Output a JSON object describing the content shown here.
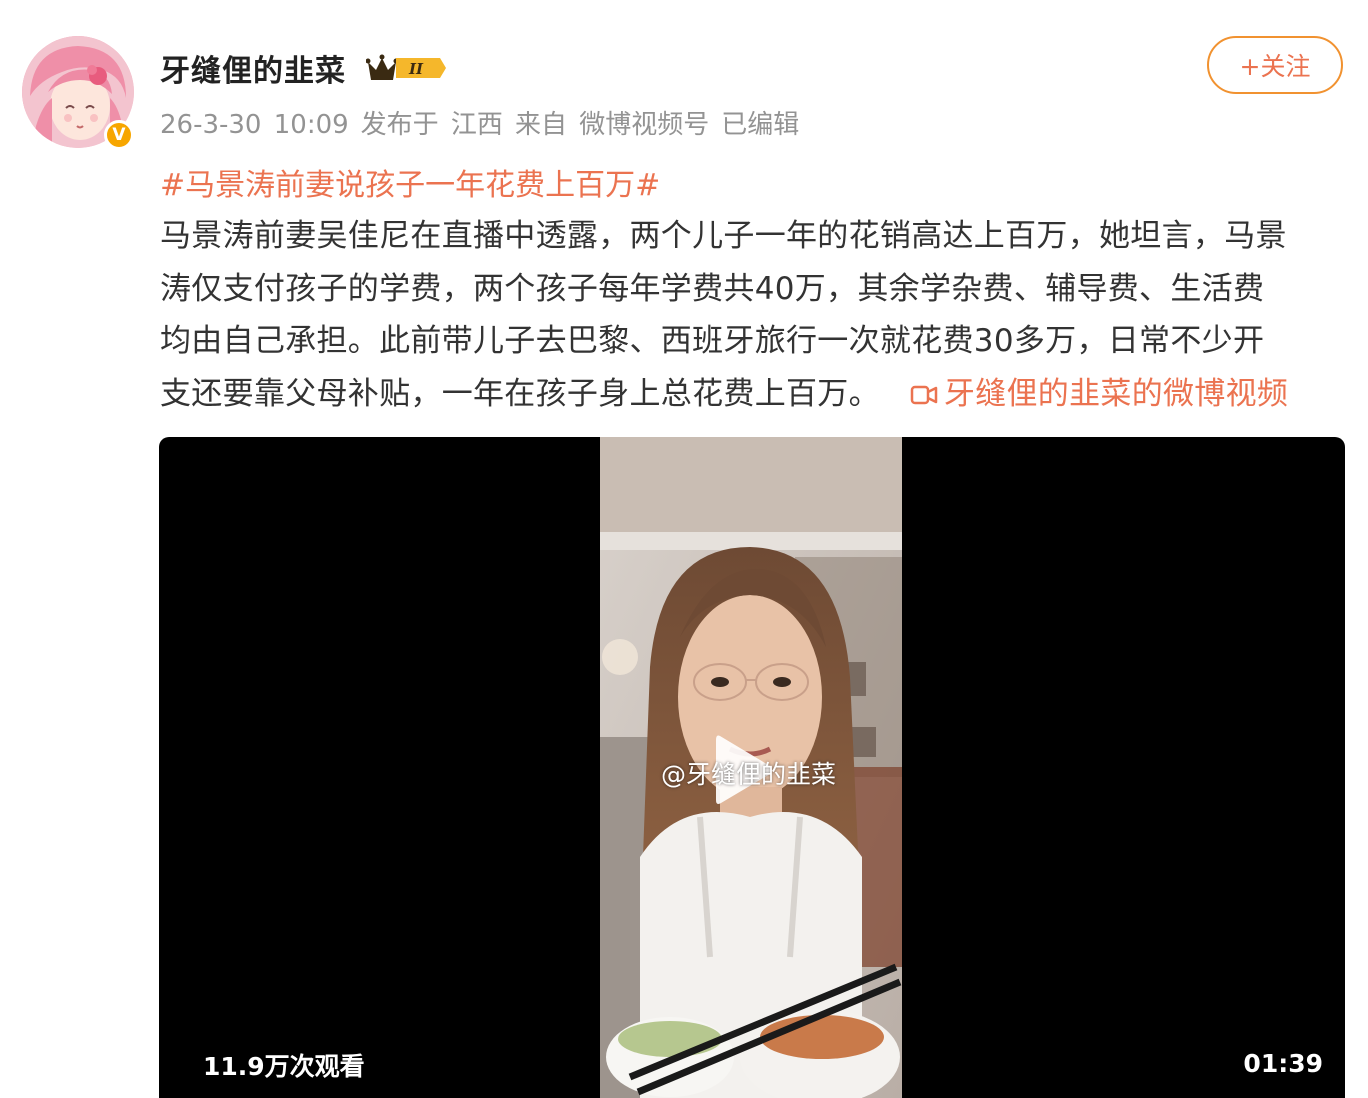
{
  "user": {
    "name": "牙缝俚的韭菜",
    "vip_level": "II",
    "verified_mark": "V"
  },
  "meta": {
    "time": "26-3-30 10:09",
    "location": "发布于 江西",
    "source": "来自 微博视频号",
    "edited": "已编辑"
  },
  "follow_button": {
    "label": "+关注"
  },
  "post": {
    "topic": "#马景涛前妻说孩子一年花费上百万#",
    "lines": [
      "马景涛前妻吴佳尼在直播中透露，两个儿子一年的花销高达上百万，她坦言，马景",
      "涛仅支付孩子的学费，两个孩子每年学费共40万，其余学杂费、辅导费、生活费",
      "均由自己承担。此前带儿子去巴黎、西班牙旅行一次就花费30多万，日常不少开",
      "支还要靠父母补贴，一年在孩子身上总花费上百万。"
    ],
    "video_link": "牙缝俚的韭菜的微博视频"
  },
  "video": {
    "watermark": "@牙缝俚的韭菜",
    "views": "11.9万次观看",
    "duration": "01:39"
  },
  "colors": {
    "accent": "#eb7350",
    "follow_border": "#f19230",
    "meta_gray": "#939393",
    "vip_gold": "#f7a600"
  },
  "icons": [
    "avatar-illustration",
    "verified-icon",
    "vip-crown-icon",
    "video-link-icon",
    "play-icon"
  ]
}
